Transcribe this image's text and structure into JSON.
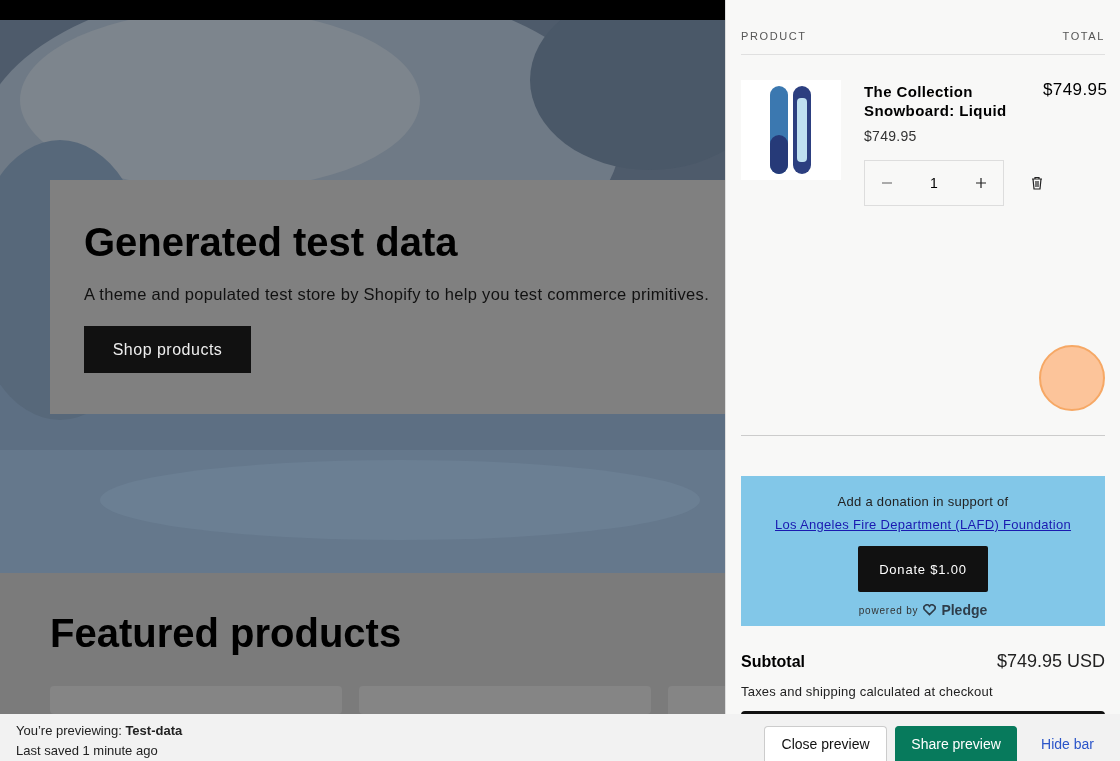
{
  "hero": {
    "title": "Generated test data",
    "text": "A theme and populated test store by Shopify to help you test commerce primitives.",
    "button": "Shop products"
  },
  "featured": {
    "heading": "Featured products"
  },
  "cart": {
    "columns": [
      "PRODUCT",
      "TOTAL"
    ],
    "items": [
      {
        "name": "The Collection Snowboard: Liquid",
        "price": "$749.95",
        "total": "$749.95",
        "quantity": "1"
      }
    ],
    "donation": {
      "text": "Add a donation in support of",
      "link": "Los Angeles Fire Department (LAFD) Foundation",
      "button": "Donate $1.00",
      "powered_by": "powered by",
      "brand": "Pledge"
    },
    "subtotal": {
      "label": "Subtotal",
      "value": "$749.95 USD"
    },
    "note": "Taxes and shipping calculated at checkout"
  },
  "preview_bar": {
    "previewing": "You’re previewing: **Test-data**",
    "last_saved": "Last saved 1 minute ago",
    "buttons": [
      {
        "label": "Close preview",
        "kind": "secondary"
      },
      {
        "label": "Share preview",
        "kind": "primary"
      },
      {
        "label": "Hide bar",
        "kind": "link"
      }
    ]
  }
}
